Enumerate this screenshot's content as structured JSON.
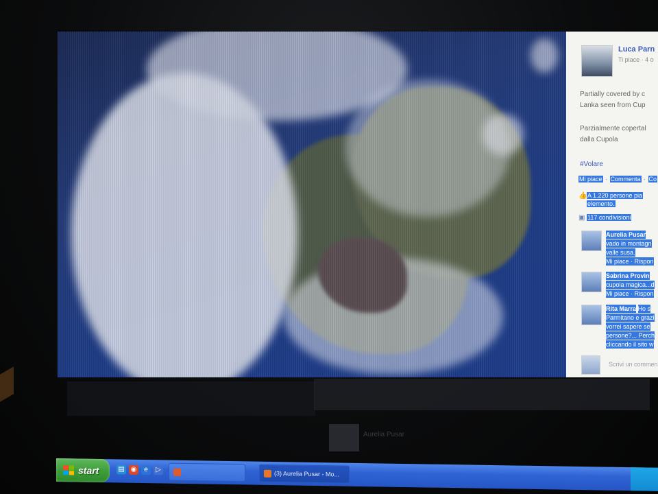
{
  "post": {
    "author": "Luca Parn",
    "meta": "Ti piace · 4 o",
    "caption_en_1": "Partially covered by c",
    "caption_en_2": "Lanka seen from Cup",
    "caption_it_1": "Parzialmente copertal",
    "caption_it_2": "dalla Cupola",
    "hashtag": "#Volare",
    "actions": {
      "like": "Mi piace",
      "comment": "Commenta",
      "share": "Co"
    },
    "likes_line_1": "A 1.220 persone pia",
    "likes_line_2": "elemento.",
    "shares": "117 condivisioni",
    "comments": [
      {
        "name": "Aurelia Pusar",
        "lines": [
          "vado in montagn",
          "valle susa."
        ],
        "actions": "Mi piace · Rispon"
      },
      {
        "name": "Sabrina Provin",
        "lines": [
          "cupola magica...d"
        ],
        "actions": "Mi piace · Rispon"
      },
      {
        "name": "Rita Marra",
        "name_suffix": "Ho s",
        "lines": [
          "Parmitano e grazi",
          "vorrei sapere se",
          "persone?... Perch",
          "cliccando il sito w"
        ],
        "actions": ""
      }
    ],
    "write_placeholder": "Scrivi un commen"
  },
  "taskbar": {
    "start_label": "start",
    "buttons": [
      {
        "label": "",
        "active": false
      },
      {
        "label": "(3) Aurelia Pusar - Mo...",
        "active": true
      }
    ]
  },
  "reflection_text": "Aurelia Pusar",
  "colors": {
    "facebook_blue": "#3b5bb8",
    "selection": "#3578e0",
    "xp_taskbar": "#2f63d4",
    "xp_start": "#3c9c38"
  }
}
